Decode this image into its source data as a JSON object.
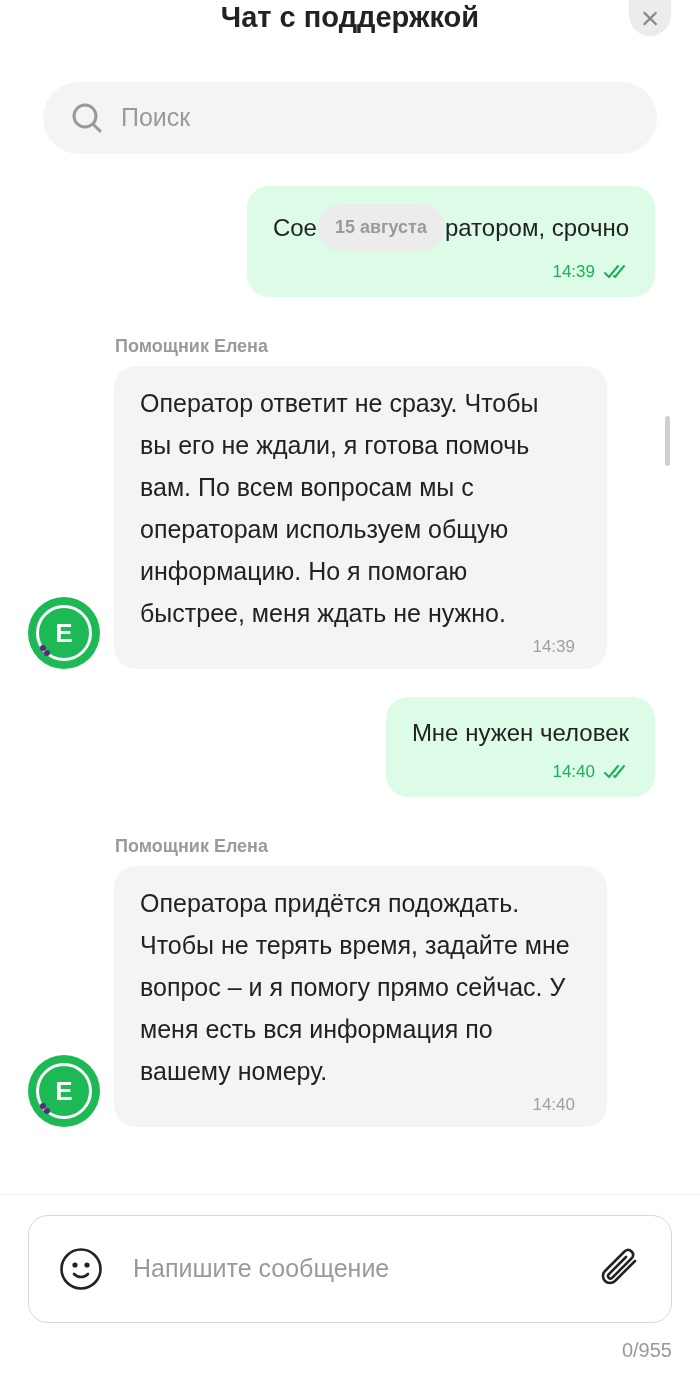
{
  "header": {
    "title": "Чат с поддержкой",
    "close_label": "×"
  },
  "search": {
    "placeholder": "Поиск"
  },
  "messages": [
    {
      "kind": "outgoing",
      "text_start": "Сое",
      "date_chip": "15 августа",
      "text_end": "ратором, срочно",
      "time": "14:39",
      "read": true
    },
    {
      "kind": "incoming",
      "sender": "Помощник Елена",
      "avatar_letter": "Е",
      "text": "Оператор ответит не сразу. Чтобы вы его не ждали, я готова помочь вам. По всем вопросам мы с операторам используем общую информацию. Но я помогаю быстрее, меня ждать не нужно.",
      "time": "14:39"
    },
    {
      "kind": "outgoing",
      "text": "Мне нужен человек",
      "time": "14:40",
      "read": true
    },
    {
      "kind": "incoming",
      "sender": "Помощник Елена",
      "avatar_letter": "Е",
      "text": "Оператора придётся подождать. Чтобы не терять время, задайте мне вопрос – и я помогу прямо сейчас. У меня есть вся информация по вашему номеру.",
      "time": "14:40"
    }
  ],
  "composer": {
    "placeholder": "Напишите сообщение",
    "counter": "0/955"
  }
}
